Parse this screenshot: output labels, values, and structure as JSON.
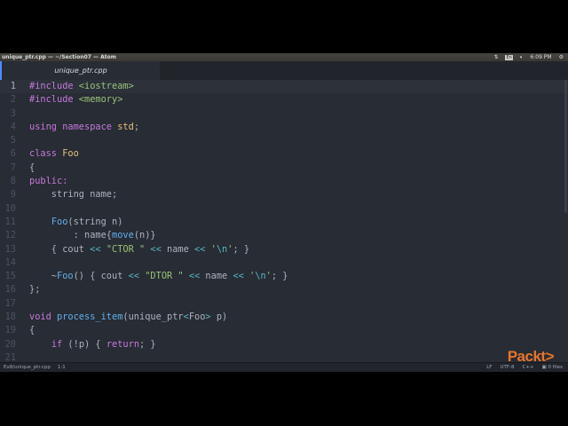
{
  "titlebar": {
    "title": "unique_ptr.cpp — ~/Section07 — Atom",
    "lang": "En",
    "time": "6:09 PM"
  },
  "tab": {
    "label": "unique_ptr.cpp"
  },
  "status": {
    "file": "Ex8/unique_ptr.cpp",
    "cursor": "1:1",
    "line_ending": "LF",
    "encoding": "UTF-8",
    "grammar": "C++",
    "files": "0 files"
  },
  "logo": "Packt>",
  "code": [
    {
      "n": "1",
      "tokens": [
        [
          "kw",
          "#include "
        ],
        [
          "str",
          "<iostream>"
        ]
      ]
    },
    {
      "n": "2",
      "tokens": [
        [
          "kw",
          "#include "
        ],
        [
          "str",
          "<memory>"
        ]
      ]
    },
    {
      "n": "3",
      "tokens": []
    },
    {
      "n": "4",
      "tokens": [
        [
          "kw",
          "using namespace "
        ],
        [
          "cls",
          "std"
        ],
        [
          "pl",
          ";"
        ]
      ]
    },
    {
      "n": "5",
      "tokens": []
    },
    {
      "n": "6",
      "tokens": [
        [
          "kw",
          "class "
        ],
        [
          "cls",
          "Foo"
        ]
      ]
    },
    {
      "n": "7",
      "tokens": [
        [
          "pl",
          "{"
        ]
      ]
    },
    {
      "n": "8",
      "tokens": [
        [
          "kw",
          "public:"
        ]
      ]
    },
    {
      "n": "9",
      "tokens": [
        [
          "pl",
          "    string name;"
        ]
      ]
    },
    {
      "n": "10",
      "tokens": []
    },
    {
      "n": "11",
      "tokens": [
        [
          "pl",
          "    "
        ],
        [
          "fn",
          "Foo"
        ],
        [
          "pl",
          "(string n)"
        ]
      ]
    },
    {
      "n": "12",
      "tokens": [
        [
          "pl",
          "        : name{"
        ],
        [
          "fn",
          "move"
        ],
        [
          "pl",
          "(n)}"
        ]
      ]
    },
    {
      "n": "13",
      "tokens": [
        [
          "pl",
          "    { cout "
        ],
        [
          "op",
          "<<"
        ],
        [
          "pl",
          " "
        ],
        [
          "str",
          "\"CTOR \""
        ],
        [
          "pl",
          " "
        ],
        [
          "op",
          "<<"
        ],
        [
          "pl",
          " name "
        ],
        [
          "op",
          "<<"
        ],
        [
          "pl",
          " "
        ],
        [
          "str",
          "'"
        ],
        [
          "op",
          "\\n"
        ],
        [
          "str",
          "'"
        ],
        [
          "pl",
          "; }"
        ]
      ]
    },
    {
      "n": "14",
      "tokens": []
    },
    {
      "n": "15",
      "tokens": [
        [
          "pl",
          "    ~"
        ],
        [
          "fn",
          "Foo"
        ],
        [
          "pl",
          "() { cout "
        ],
        [
          "op",
          "<<"
        ],
        [
          "pl",
          " "
        ],
        [
          "str",
          "\"DTOR \""
        ],
        [
          "pl",
          " "
        ],
        [
          "op",
          "<<"
        ],
        [
          "pl",
          " name "
        ],
        [
          "op",
          "<<"
        ],
        [
          "pl",
          " "
        ],
        [
          "str",
          "'"
        ],
        [
          "op",
          "\\n"
        ],
        [
          "str",
          "'"
        ],
        [
          "pl",
          "; }"
        ]
      ]
    },
    {
      "n": "16",
      "tokens": [
        [
          "pl",
          "};"
        ]
      ]
    },
    {
      "n": "17",
      "tokens": []
    },
    {
      "n": "18",
      "tokens": [
        [
          "kw",
          "void "
        ],
        [
          "fn",
          "process_item"
        ],
        [
          "pl",
          "(unique_ptr"
        ],
        [
          "op",
          "<"
        ],
        [
          "pl",
          "Foo"
        ],
        [
          "op",
          ">"
        ],
        [
          "pl",
          " p)"
        ]
      ]
    },
    {
      "n": "19",
      "tokens": [
        [
          "pl",
          "{"
        ]
      ]
    },
    {
      "n": "20",
      "tokens": [
        [
          "pl",
          "    "
        ],
        [
          "kw",
          "if"
        ],
        [
          "pl",
          " (!p) { "
        ],
        [
          "kw",
          "return"
        ],
        [
          "pl",
          "; }"
        ]
      ]
    },
    {
      "n": "21",
      "tokens": []
    }
  ]
}
